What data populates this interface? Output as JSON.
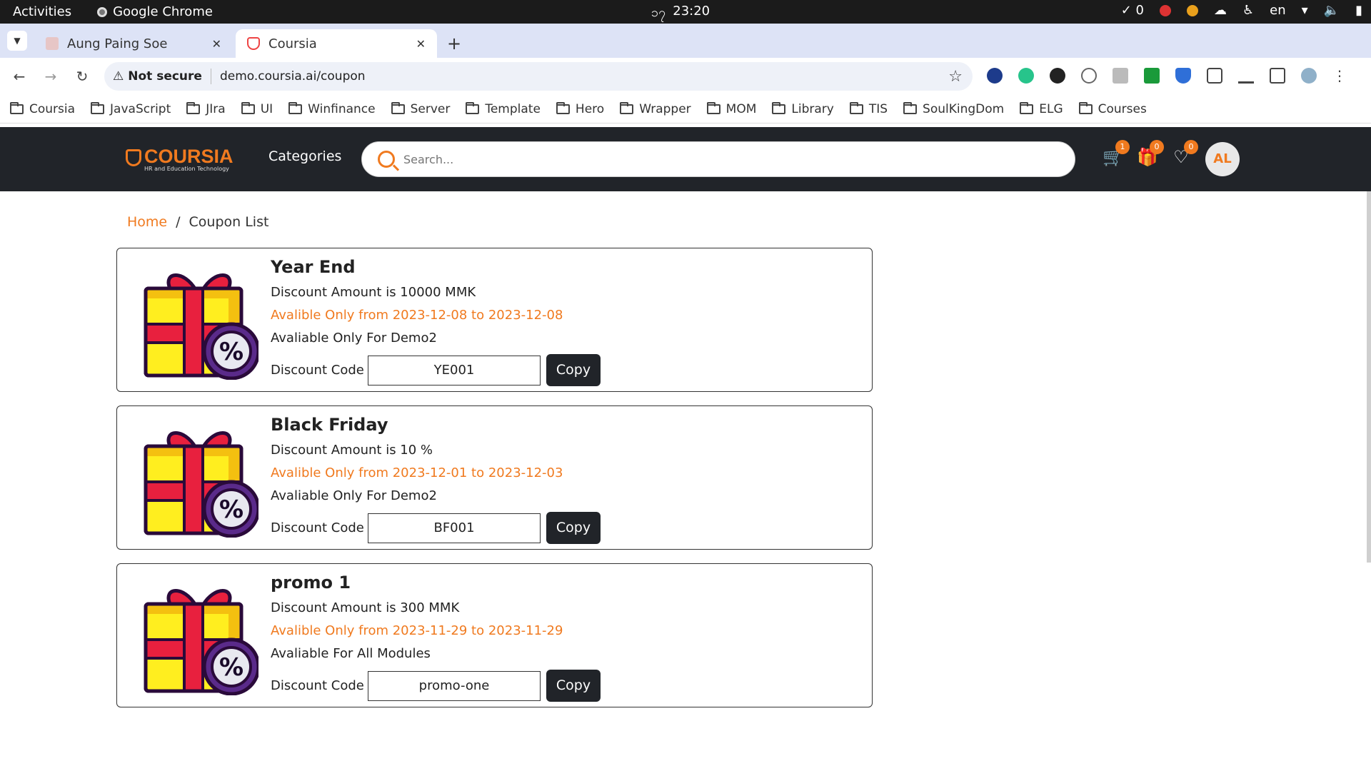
{
  "os": {
    "activities": "Activities",
    "app_name": "Google Chrome",
    "clock_prefix": "၁၇",
    "day": "17",
    "time": "23:20",
    "notifications": "0",
    "lang": "en"
  },
  "tabs": [
    {
      "title": "Aung Paing Soe"
    },
    {
      "title": "Coursia"
    }
  ],
  "address": {
    "security_label": "Not secure",
    "url": "demo.coursia.ai/coupon"
  },
  "bookmarks": [
    "Coursia",
    "JavaScript",
    "JIra",
    "UI",
    "Winfinance",
    "Server",
    "Template",
    "Hero",
    "Wrapper",
    "MOM",
    "Library",
    "TIS",
    "SoulKingDom",
    "ELG",
    "Courses"
  ],
  "site": {
    "logo_text": "COURSIA",
    "logo_tagline": "HR and Education Technology",
    "categories_label": "Categories",
    "search_placeholder": "Search...",
    "cart_count": "1",
    "gift_count": "0",
    "wishlist_count": "0",
    "avatar_initials": "AL",
    "brand_color": "#f07a1f",
    "header_bg": "#212429"
  },
  "breadcrumb": {
    "home": "Home",
    "separator": "/",
    "current": "Coupon List"
  },
  "coupons": [
    {
      "title": "Year End",
      "amount": "Discount Amount is 10000 MMK",
      "availability": "Avalible Only from 2023-12-08 to 2023-12-08",
      "scope": "Avaliable Only For Demo2",
      "code_label": "Discount Code",
      "code": "YE001",
      "copy_label": "Copy"
    },
    {
      "title": "Black Friday",
      "amount": "Discount Amount is 10 %",
      "availability": "Avalible Only from 2023-12-01 to 2023-12-03",
      "scope": "Avaliable Only For Demo2",
      "code_label": "Discount Code",
      "code": "BF001",
      "copy_label": "Copy"
    },
    {
      "title": "promo 1",
      "amount": "Discount Amount is 300 MMK",
      "availability": "Avalible Only from 2023-11-29 to 2023-11-29",
      "scope": "Avaliable For All Modules",
      "code_label": "Discount Code",
      "code": "promo-one",
      "copy_label": "Copy"
    }
  ]
}
